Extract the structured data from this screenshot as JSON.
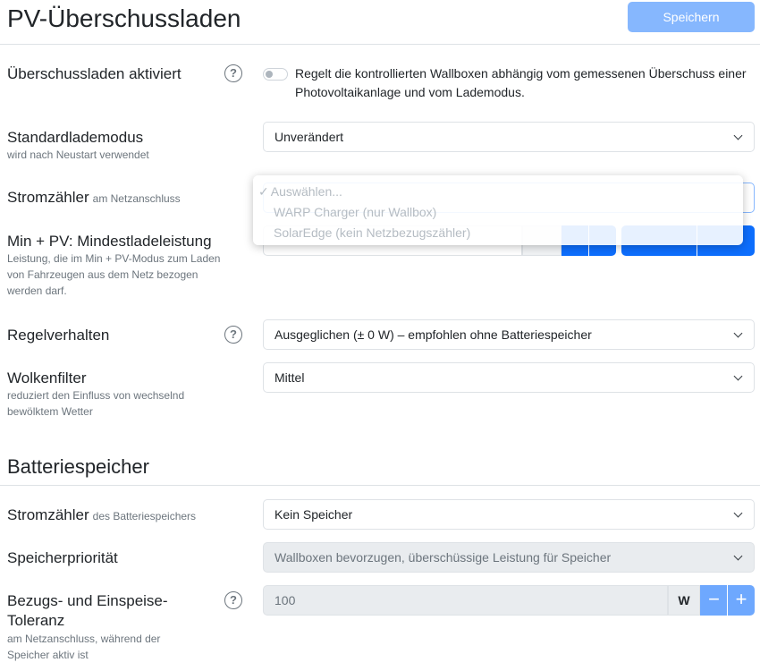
{
  "header": {
    "title": "PV-Überschussladen",
    "save_label": "Speichern"
  },
  "pv": {
    "enable": {
      "label": "Überschussladen aktiviert",
      "description": "Regelt die kontrollierten Wallboxen abhängig vom gemessenen Überschuss einer Photovoltaikanlage und vom Lademodus.",
      "checked": false
    },
    "default_mode": {
      "label": "Standardlademodus",
      "sub": "wird nach Neustart verwendet",
      "value": "Unverändert"
    },
    "meter": {
      "label": "Stromzähler",
      "inline_sub": "am Netzanschluss",
      "dropdown": [
        {
          "label": "Auswählen...",
          "checked": true
        },
        {
          "label": "WARP Charger (nur Wallbox)",
          "checked": false
        },
        {
          "label": "SolarEdge (kein Netzbezugszähler)",
          "checked": false
        }
      ]
    },
    "min_pv": {
      "label": "Min + PV: Mindestladeleistung",
      "sub": "Leistung, die im Min + PV-Modus zum Laden von Fahrzeugen aus dem Netz bezogen werden darf."
    },
    "control": {
      "label": "Regelverhalten",
      "value": "Ausgeglichen (± 0 W) – empfohlen ohne Batteriespeicher"
    },
    "cloud": {
      "label": "Wolkenfilter",
      "sub": "reduziert den Einfluss von wechselnd bewölktem Wetter",
      "value": "Mittel"
    }
  },
  "battery": {
    "title": "Batteriespeicher",
    "meter": {
      "label": "Stromzähler",
      "inline_sub": "des Batteriespeichers",
      "value": "Kein Speicher"
    },
    "priority": {
      "label": "Speicherpriorität",
      "value": "Wallboxen bevorzugen, überschüssige Leistung für Speicher"
    },
    "tolerance": {
      "label": "Bezugs- und Einspeise-Toleranz",
      "sub": "am Netzanschluss, während der Speicher aktiv ist",
      "value": "100",
      "unit": "W",
      "minus": "−",
      "plus": "+"
    }
  },
  "icons": {
    "help": "question-circle-icon",
    "chevron": "chevron-down-icon",
    "check": "check-icon"
  }
}
